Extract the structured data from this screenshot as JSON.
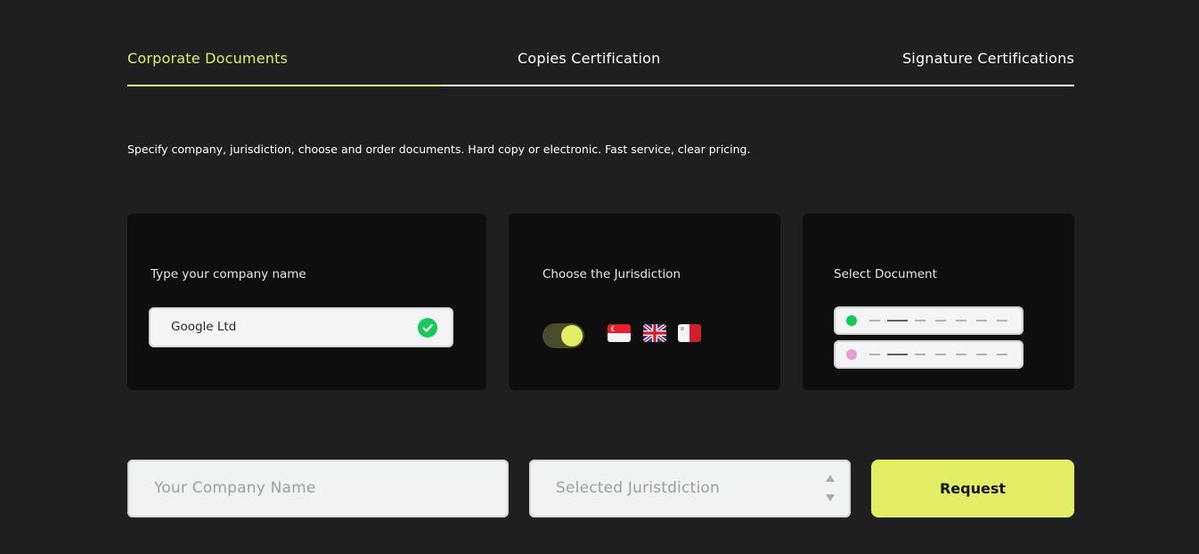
{
  "tabs": [
    {
      "label": "Corporate Documents",
      "active": true
    },
    {
      "label": "Copies Certification",
      "active": false
    },
    {
      "label": "Signature Certifications",
      "active": false
    }
  ],
  "description": "Specify company, jurisdiction, choose and order documents. Hard copy or electronic. Fast service, clear pricing.",
  "cards": {
    "company": {
      "title": "Type your company name",
      "example_value": "Google Ltd",
      "status_icon": "check-circle-icon"
    },
    "jurisdiction": {
      "title": "Choose the Jurisdiction",
      "toggle_on": true,
      "flags": [
        "singapore-flag-icon",
        "uk-flag-icon",
        "malta-flag-icon"
      ]
    },
    "document": {
      "title": "Select Document",
      "rows": [
        {
          "dot_color": "#18c85a"
        },
        {
          "dot_color": "#e89ad2"
        }
      ]
    }
  },
  "form": {
    "company_placeholder": "Your Company Name",
    "jurisdiction_placeholder": "Selected Juristdiction",
    "request_label": "Request"
  },
  "colors": {
    "accent": "#e2ef65",
    "background": "#1f1f1f",
    "card": "#0e0e0e",
    "success": "#18c85a"
  }
}
